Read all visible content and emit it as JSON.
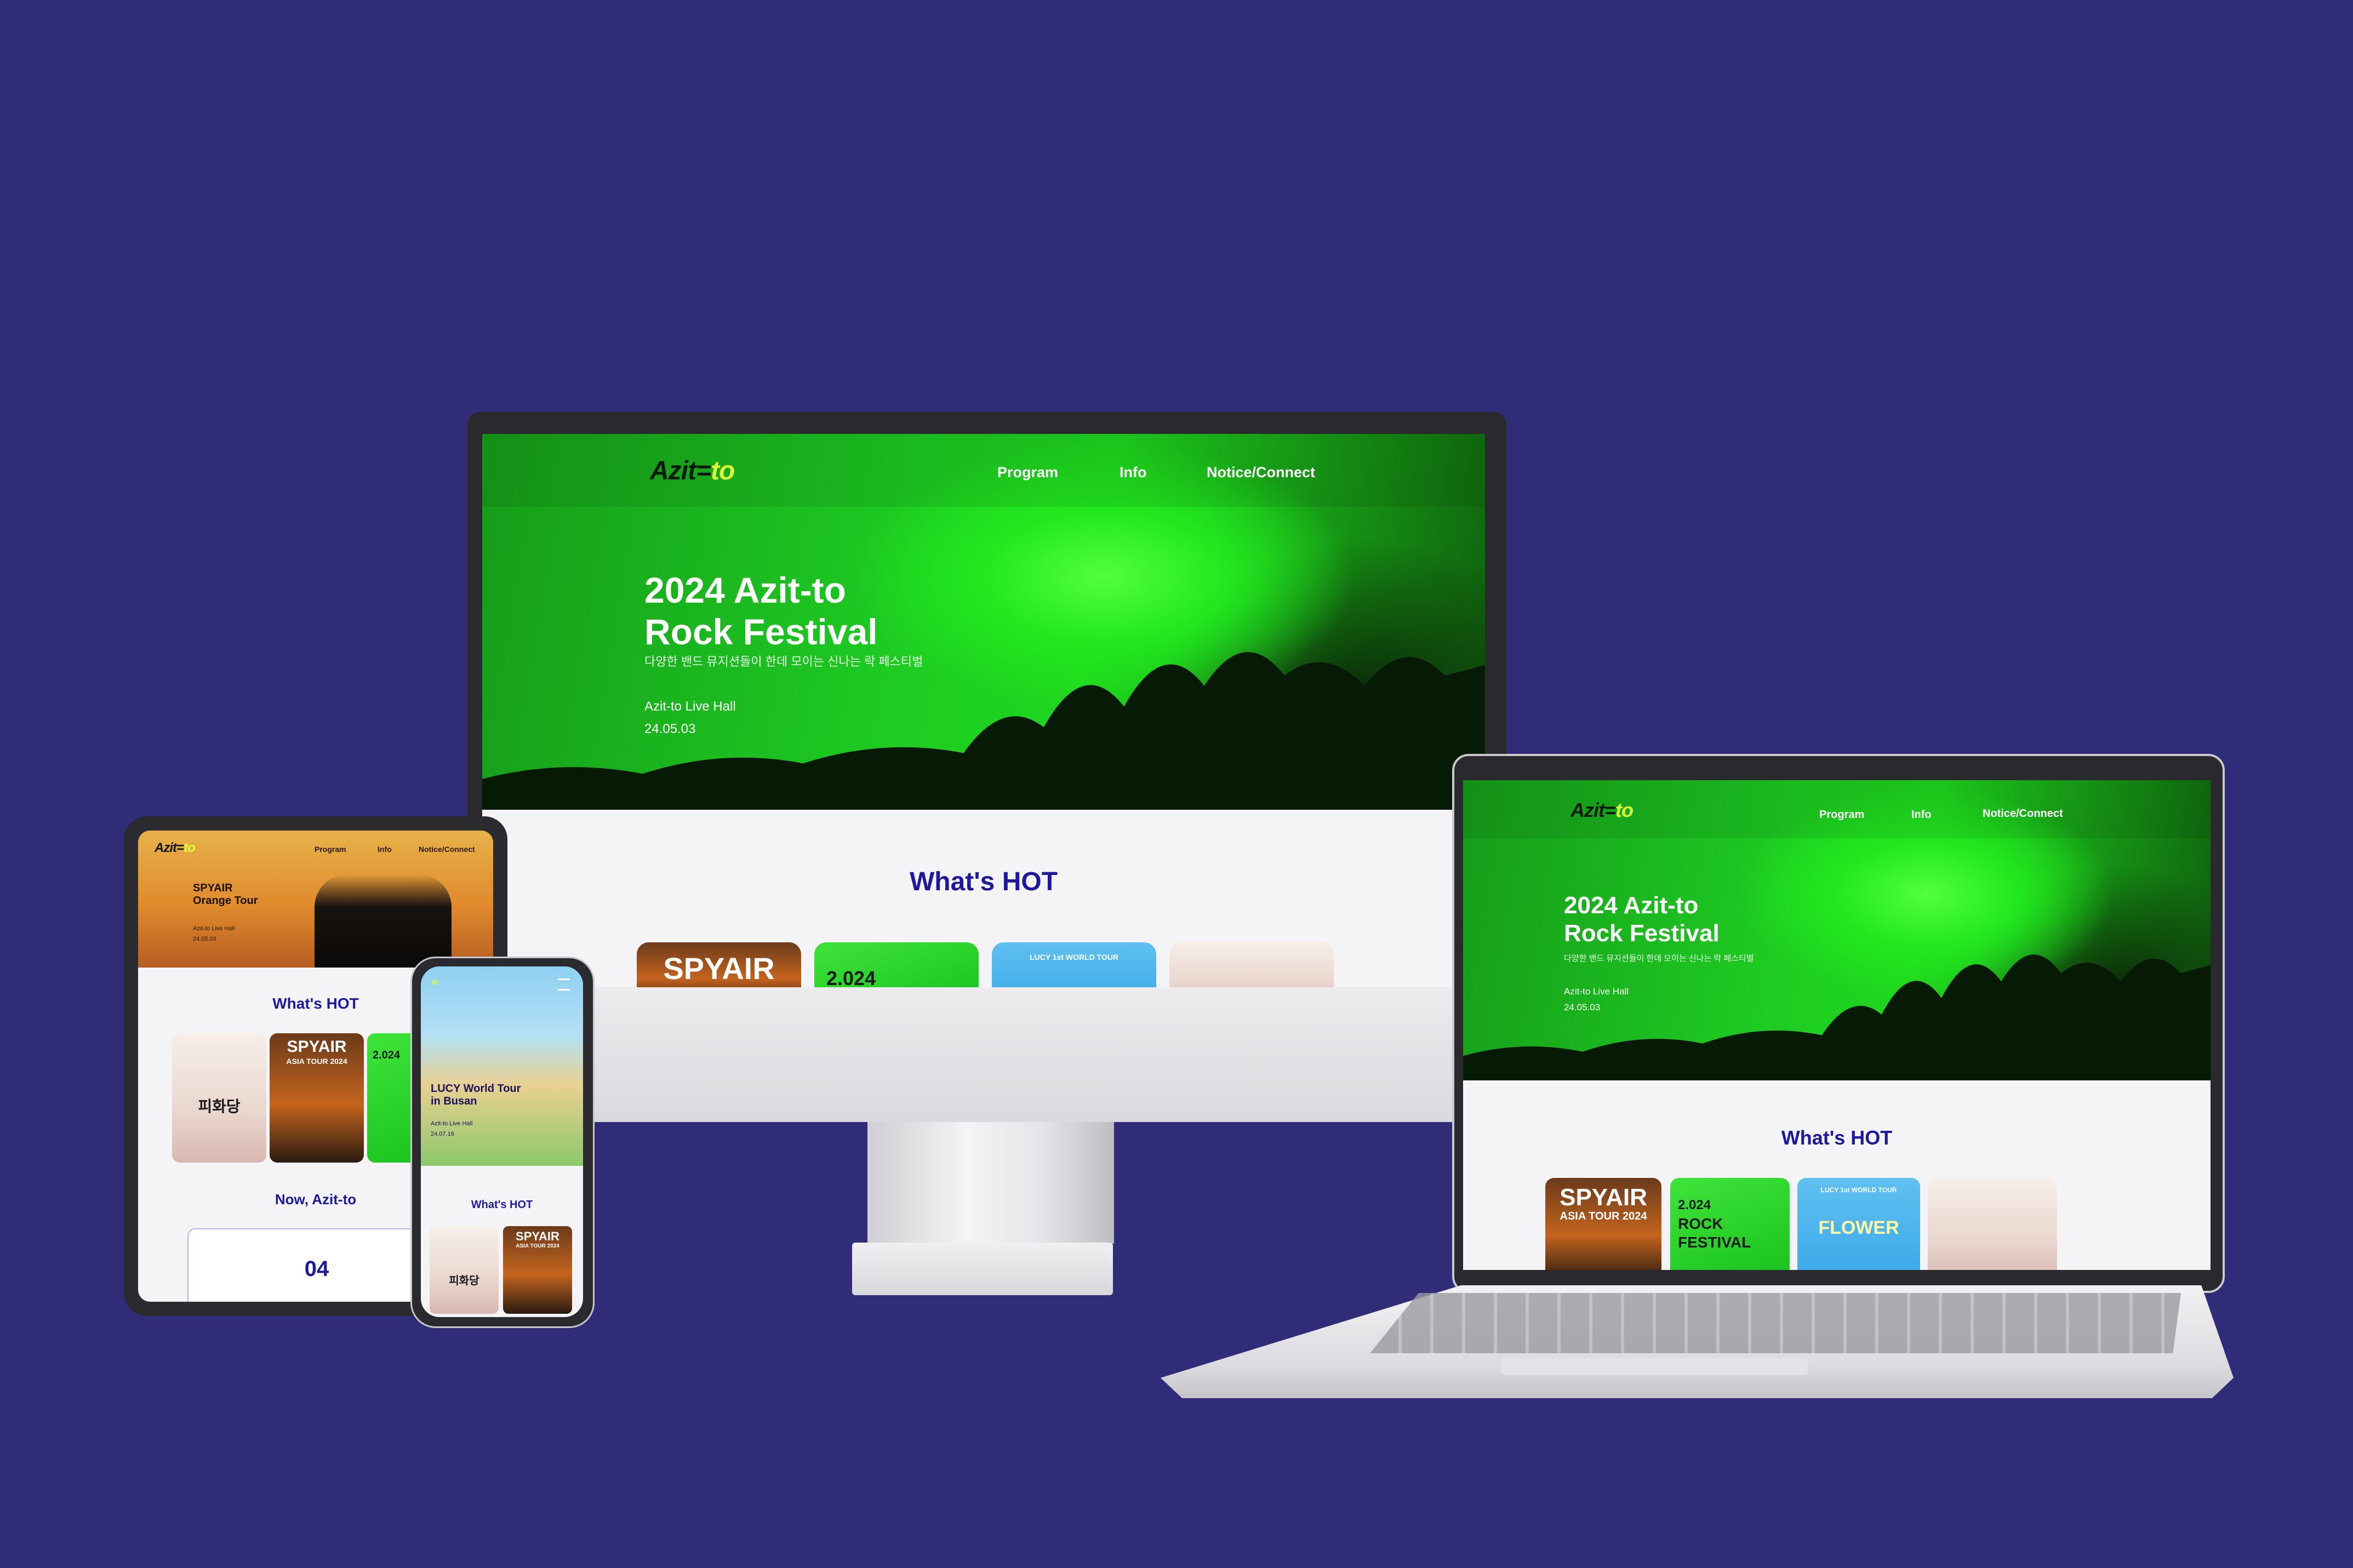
{
  "site": {
    "logo": "Azit",
    "logo_accent": "to",
    "nav": [
      "Program",
      "Info",
      "Notice/Connect"
    ]
  },
  "festival": {
    "title_line1": "2024 Azit-to",
    "title_line2": "Rock Festival",
    "subtitle": "다양한 밴드 뮤지션들이 한데 모이는 신나는 락 페스티벌",
    "venue": "Azit-to Live Hall",
    "date": "24.05.03"
  },
  "tablet_hero": {
    "artist": "SPYAIR",
    "title": "Orange Tour",
    "venue": "Azit-to Live Hall",
    "date": "24.05.03"
  },
  "phone_hero": {
    "title_line1": "LUCY World Tour",
    "title_line2": "in Busan",
    "venue": "Azit-to Live Hall",
    "date": "24.07.16"
  },
  "sections": {
    "whats_hot": "What's HOT",
    "now": "Now, Azit-to",
    "now_count": "04"
  },
  "cards": {
    "spyair": "SPYAIR",
    "spyair_tour": "ASIA TOUR 2024",
    "rock_year": "2.024",
    "rock_word": "ROCK",
    "rock_fest": "FESTIVAL",
    "lucy_small": "LUCY 1st WORLD TOUR",
    "lucy_flower": "FLOWER",
    "pi": "피화당"
  },
  "colors": {
    "background": "#302c78",
    "accent_green": "#1fd61e",
    "heading_blue": "#1e189c"
  }
}
